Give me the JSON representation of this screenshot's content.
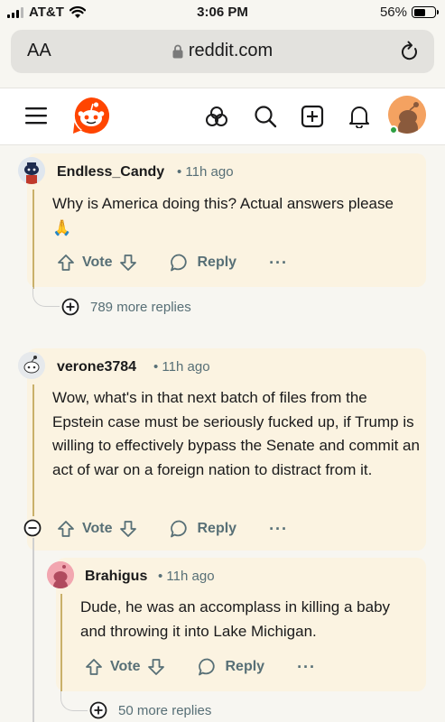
{
  "status": {
    "carrier": "AT&T",
    "time": "3:06 PM",
    "battery_percent": "56%",
    "battery_level": 0.56
  },
  "browser": {
    "text_size_label": "AA",
    "host": "reddit.com"
  },
  "nav": {
    "icons": [
      "menu-icon",
      "reddit-logo",
      "communities-icon",
      "search-icon",
      "create-post-icon",
      "notifications-icon",
      "avatar"
    ]
  },
  "comments": [
    {
      "username": "Endless_Candy",
      "time": "11h ago",
      "body": "Why is America doing this? Actual answers please 🙏",
      "vote_label": "Vote",
      "reply_label": "Reply",
      "more_label": "···",
      "more_replies": "789 more replies"
    },
    {
      "username": "verone3784",
      "time": "11h ago",
      "body": "Wow, what's in that next batch of files from the Epstein case must be seriously fucked up, if Trump is willing to effectively bypass the Senate and commit an act of war on a foreign nation to distract from it.",
      "vote_label": "Vote",
      "reply_label": "Reply",
      "more_label": "···"
    },
    {
      "username": "Brahigus",
      "time": "11h ago",
      "body": "Dude, he was an accomplass in killing a baby and throwing it into Lake Michigan.",
      "vote_label": "Vote",
      "reply_label": "Reply",
      "more_label": "···",
      "more_replies": "50 more replies"
    }
  ],
  "colors": {
    "accent": "#ff4500",
    "card_bg": "#fbf3e1",
    "thread_line": "#c9b06a"
  }
}
